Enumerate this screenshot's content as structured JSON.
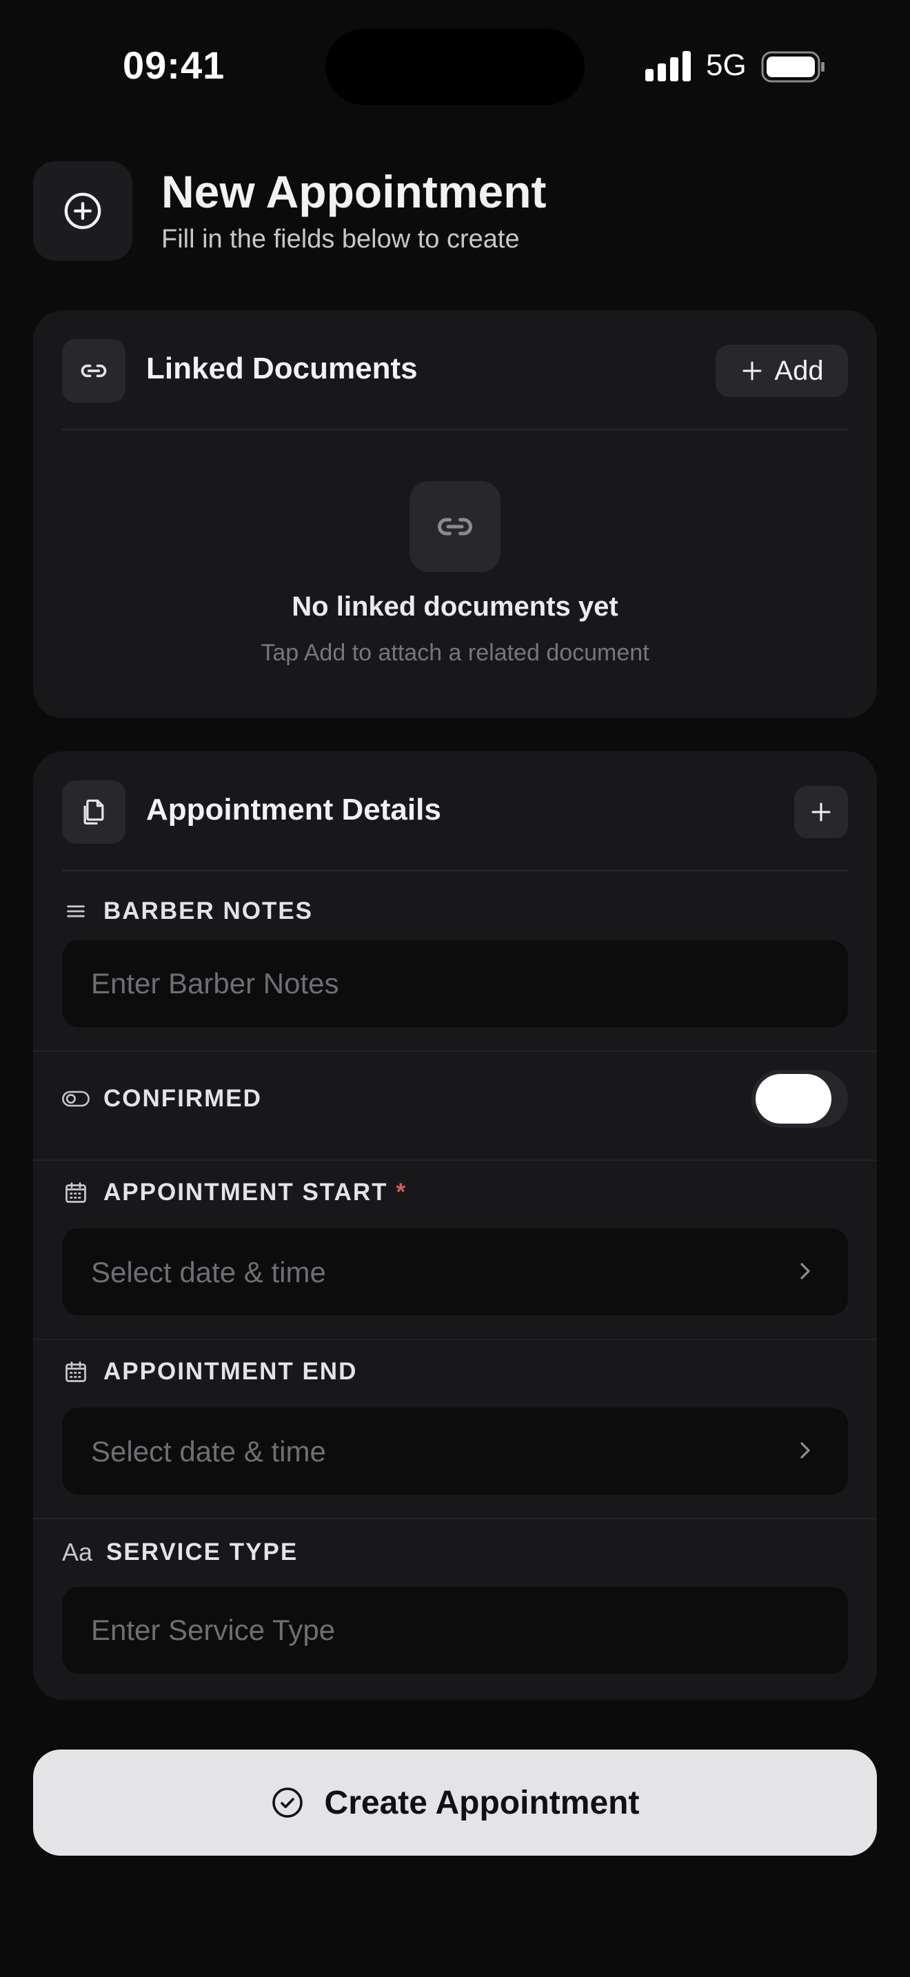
{
  "status_bar": {
    "time": "09:41",
    "network": "5G"
  },
  "header": {
    "title": "New Appointment",
    "subtitle": "Fill in the fields below to create"
  },
  "linked_documents": {
    "title": "Linked Documents",
    "add_label": "Add",
    "empty_title": "No linked documents yet",
    "empty_subtitle": "Tap Add to attach a related document"
  },
  "details": {
    "title": "Appointment Details",
    "barber_notes": {
      "label": "BARBER NOTES",
      "placeholder": "Enter Barber Notes"
    },
    "confirmed": {
      "label": "CONFIRMED",
      "value": false
    },
    "appointment_start": {
      "label": "APPOINTMENT START",
      "required_mark": "*",
      "placeholder": "Select date & time"
    },
    "appointment_end": {
      "label": "APPOINTMENT END",
      "placeholder": "Select date & time"
    },
    "service_type": {
      "label": "SERVICE TYPE",
      "icon_text": "Aa",
      "placeholder": "Enter Service Type"
    }
  },
  "submit": {
    "label": "Create Appointment"
  },
  "icons": [
    "plus-circle-icon",
    "link-icon",
    "plus-icon",
    "documents-icon",
    "lines-icon",
    "toggle-icon",
    "calendar-icon",
    "chevron-right-icon",
    "text-icon",
    "check-circle-icon"
  ],
  "colors": {
    "background": "#0b0b0c",
    "card": "#18181b",
    "field": "#0c0c0d",
    "primary_button": "#e4e4e7",
    "required": "#e05757"
  }
}
